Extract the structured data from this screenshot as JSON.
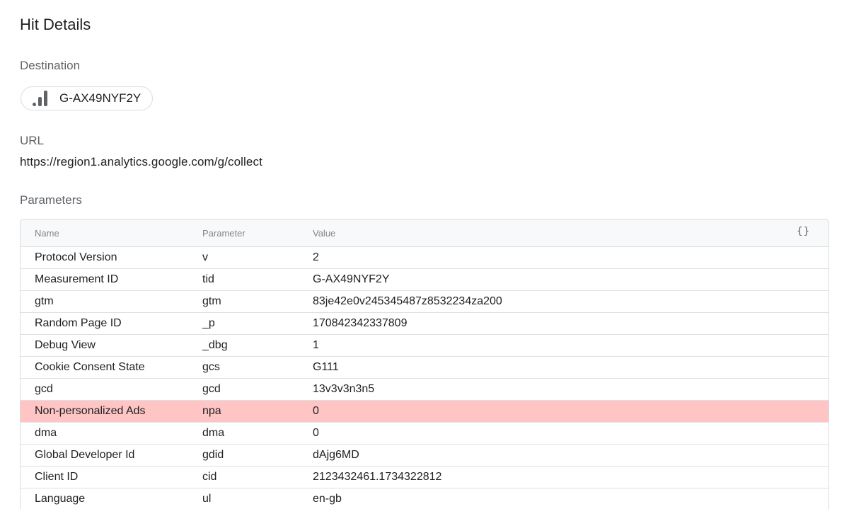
{
  "page": {
    "title": "Hit Details"
  },
  "destination": {
    "label": "Destination",
    "chip_text": "G-AX49NYF2Y",
    "chip_icon": "analytics-bars-icon"
  },
  "url": {
    "label": "URL",
    "value": "https://region1.analytics.google.com/g/collect"
  },
  "parameters": {
    "label": "Parameters",
    "headers": {
      "name": "Name",
      "parameter": "Parameter",
      "value": "Value"
    },
    "json_toggle_icon": "{}",
    "highlight_color": "#ffc4c4",
    "rows": [
      {
        "name": "Protocol Version",
        "parameter": "v",
        "value": "2"
      },
      {
        "name": "Measurement ID",
        "parameter": "tid",
        "value": "G-AX49NYF2Y"
      },
      {
        "name": "gtm",
        "parameter": "gtm",
        "value": "83je42e0v245345487z8532234za200"
      },
      {
        "name": "Random Page ID",
        "parameter": "_p",
        "value": "170842342337809"
      },
      {
        "name": "Debug View",
        "parameter": "_dbg",
        "value": "1"
      },
      {
        "name": "Cookie Consent State",
        "parameter": "gcs",
        "value": "G111"
      },
      {
        "name": "gcd",
        "parameter": "gcd",
        "value": "13v3v3n3n5"
      },
      {
        "name": "Non-personalized Ads",
        "parameter": "npa",
        "value": "0"
      },
      {
        "name": "dma",
        "parameter": "dma",
        "value": "0"
      },
      {
        "name": "Global Developer Id",
        "parameter": "gdid",
        "value": "dAjg6MD"
      },
      {
        "name": "Client ID",
        "parameter": "cid",
        "value": "2123432461.1734322812"
      },
      {
        "name": "Language",
        "parameter": "ul",
        "value": "en-gb"
      }
    ]
  }
}
